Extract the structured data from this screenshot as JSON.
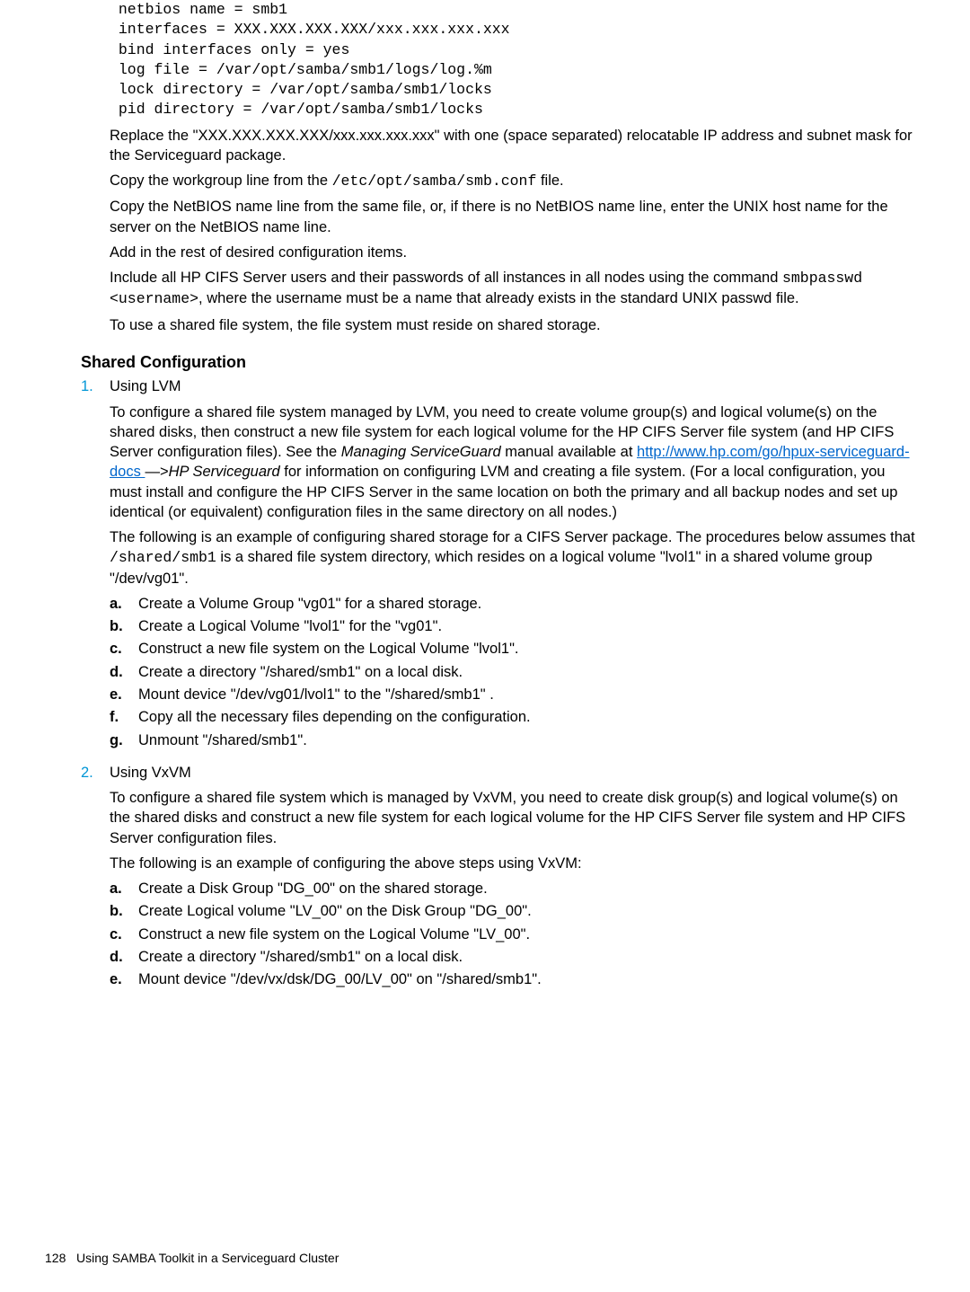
{
  "code_block": " netbios name = smb1\n interfaces = XXX.XXX.XXX.XXX/xxx.xxx.xxx.xxx\n bind interfaces only = yes\n log file = /var/opt/samba/smb1/logs/log.%m\n lock directory = /var/opt/samba/smb1/locks\n pid directory = /var/opt/samba/smb1/locks",
  "p1a": "Replace the \"XXX.XXX.XXX.XXX/xxx.xxx.xxx.xxx\" with one (space separated) relocatable IP address and subnet mask for the Serviceguard package.",
  "p2a": "Copy the workgroup line from the ",
  "p2b": "/etc/opt/samba/smb.conf",
  "p2c": " file.",
  "p3": "Copy the NetBIOS name line from the same file, or, if there is no NetBIOS name line, enter the UNIX host name for the server on the NetBIOS name line.",
  "p4": "Add in the rest of desired configuration items.",
  "p5a": "Include all HP CIFS Server users and their passwords of all instances in all nodes using the command ",
  "p5b": "smbpasswd <username>",
  "p5c": ", where the username must be a name that already exists in the standard UNIX passwd file.",
  "p6": "To use a shared file system, the file system must reside on shared storage.",
  "section_title": "Shared Configuration",
  "s1_title": "Using LVM",
  "s1_p1a": "To configure a shared file system managed by LVM, you need to create volume group(s) and logical volume(s) on the shared disks, then construct a new file system for each logical volume for the HP CIFS Server file system (and HP CIFS Server configuration files). See the ",
  "s1_p1b": "Managing ServiceGuard",
  "s1_p1c": " manual available at ",
  "s1_link": "http://www.hp.com/go/hpux-serviceguard-docs ",
  "s1_p1d": " —>",
  "s1_p1e": "HP Serviceguard ",
  "s1_p1f": " for information on configuring LVM and creating a file system. (For a local configuration, you must install and configure the HP CIFS Server in the same location on both the primary and all backup nodes and set up identical (or equivalent) configuration files in the same directory on all nodes.)",
  "s1_p2a": "The following is an example of configuring shared storage for a CIFS Server package. The procedures below assumes that ",
  "s1_p2b": "/shared/smb1",
  "s1_p2c": " is a shared file system directory, which resides on a logical volume \"lvol1\" in a shared volume group \"/dev/vg01\".",
  "s1_steps": [
    "Create a Volume Group \"vg01\" for a shared storage.",
    "Create a Logical Volume \"lvol1\" for the \"vg01\".",
    "Construct a new file system on the Logical Volume \"lvol1\".",
    "Create a directory \"/shared/smb1\" on a local disk.",
    "Mount device \"/dev/vg01/lvol1\" to the \"/shared/smb1\" .",
    "Copy all the necessary files depending on the configuration.",
    "Unmount \"/shared/smb1\"."
  ],
  "s2_title": "Using VxVM",
  "s2_p1": "To configure a shared file system which is managed by VxVM, you need to create disk group(s) and logical volume(s) on the shared disks and construct a new file system for each logical volume for the HP CIFS Server file system and HP CIFS Server configuration files.",
  "s2_p2": "The following is an example of configuring the above steps using VxVM:",
  "s2_steps": [
    "Create a Disk Group \"DG_00\" on the shared storage.",
    "Create Logical volume \"LV_00\" on the Disk Group \"DG_00\".",
    "Construct a new file system on the Logical Volume \"LV_00\".",
    "Create a directory \"/shared/smb1\" on a local disk.",
    "Mount device \"/dev/vx/dsk/DG_00/LV_00\" on \"/shared/smb1\"."
  ],
  "footer_page": "128",
  "footer_text": "Using SAMBA Toolkit in a Serviceguard Cluster",
  "alpha_markers": [
    "a.",
    "b.",
    "c.",
    "d.",
    "e.",
    "f.",
    "g."
  ],
  "num1": "1.",
  "num2": "2."
}
